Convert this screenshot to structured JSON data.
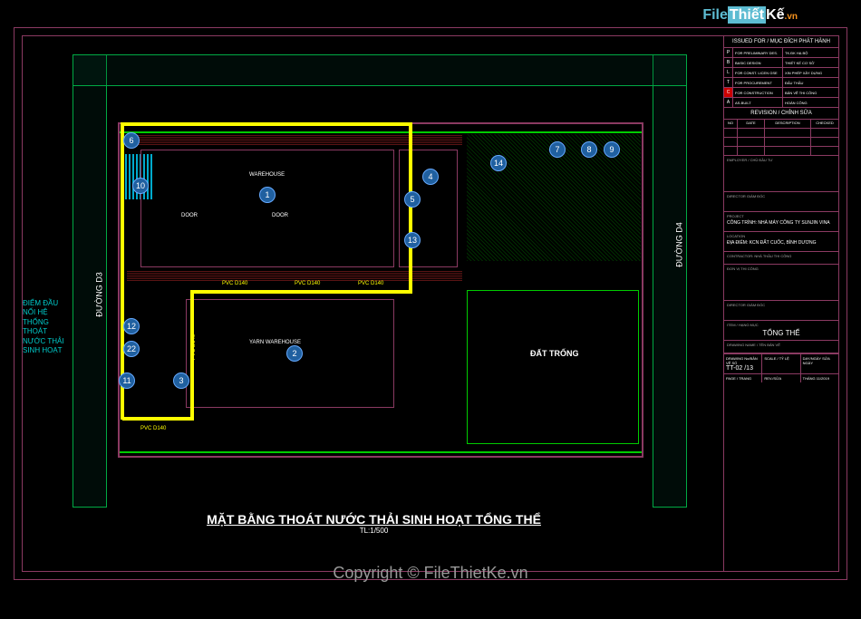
{
  "watermark": {
    "file": "File",
    "thiet": "Thiết",
    "ke": "Kế",
    "vn": ".vn"
  },
  "copyright": "Copyright © FileThietKe.vn",
  "drawing": {
    "title_main": "MẶT BẰNG THOÁT NƯỚC THẢI SINH HOẠT TỔNG THỂ",
    "title_scale": "TL:1/500",
    "road_left": "ĐƯỜNG D3",
    "road_right": "ĐƯỜNG D4",
    "side_label": "ĐIỂM ĐẦU NỐI HỆ THỐNG THOÁT NƯỚC THẢI SINH HOẠT",
    "warehouse": "WAREHOUSE",
    "door": "DOOR",
    "yarn_warehouse": "YARN WAREHOUSE",
    "empty_land": "ĐẤT TRỐNG",
    "pipe_label": "PVC D140",
    "parking": "PVC D140"
  },
  "nodes": {
    "n1": "1",
    "n2": "2",
    "n3": "3",
    "n4": "4",
    "n5": "5",
    "n6": "6",
    "n7": "7",
    "n8": "8",
    "n9": "9",
    "n10": "10",
    "n11": "11",
    "n12": "12",
    "n13": "13",
    "n14": "14",
    "n22": "22"
  },
  "titleblock": {
    "issued_header": "ISSUED FOR / MỤC ĐÍCH PHÁT HÀNH",
    "issue_rows": [
      {
        "sym": "P",
        "label": "FOR PRELIMINARY DES.",
        "val": "TK.ĐK HẠ BỘ"
      },
      {
        "sym": "B",
        "label": "BASIC DESIGN",
        "val": "THIẾT KẾ CƠ SỞ"
      },
      {
        "sym": "L",
        "label": "FOR CONST. LICEN GSE",
        "val": "XIN PHÉP XÂY DỰNG"
      },
      {
        "sym": "T",
        "label": "FOR PROCUREMENT",
        "val": "ĐẤU THẦU"
      },
      {
        "sym": "C",
        "label": "FOR CONSTRUCTION",
        "val": "BẢN VẼ THI CÔNG"
      },
      {
        "sym": "A",
        "label": "AS-BUILT",
        "val": "HOÀN CÔNG"
      }
    ],
    "revision_header": "REVISION / CHỈNH SỬA",
    "rev_cols": {
      "no": "NO",
      "date": "DATE",
      "desc": "DESCRIPTION",
      "chk": "CHECKED"
    },
    "employer_label": "EMPLOYER / CHỦ ĐẦU TƯ",
    "employer": "",
    "director_label": "DIRECTOR GIÁM ĐỐC",
    "project_label": "PROJECT",
    "project": "CÔNG TRÌNH: NHÀ MÁY CÔNG TY SUNJIN VINA",
    "location_label": "LOCATION",
    "location": "ĐỊA ĐIỂM: KCN ĐẤT CUỐC, BÌNH DƯƠNG",
    "contractor_label": "CONTRACTOR: NHÀ THẦU THI CÔNG",
    "unit_label": "ĐƠN VỊ THI CÔNG",
    "item_label": "ITEM / HẠNG MỤC",
    "item": "TỔNG THỂ",
    "drawing_name_label": "DRAWING NAME / TÊN BẢN VẼ",
    "dwg_no_label": "DRAWING No/BẢN VẼ SỐ",
    "dwg_no": "TT-02 /13",
    "scale_label": "SCALE / TỶ LỆ",
    "date_label": "DATE / NGÀY",
    "date": "THÁNG 11/2019",
    "page_label": "PAGE / TRANG",
    "rev_label": "REV./SỬA",
    "day_label": "DAY/NGÀY SỬA NGÀY"
  }
}
